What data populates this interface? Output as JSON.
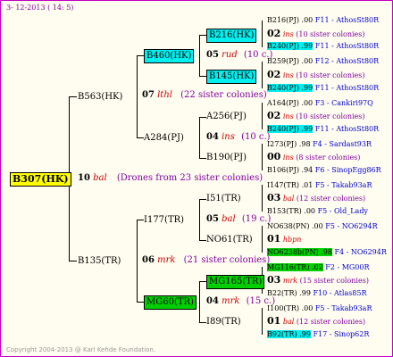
{
  "header": {
    "date": "3- 12-2013 ( 14: 5)"
  },
  "footer": {
    "copyright": "Copyright 2004-2013 @ Karl Kehde Foundation."
  },
  "colors": {
    "frame": "#c000c0",
    "cyan": "#00f0f0",
    "green": "#00d000",
    "root": "#ffff00",
    "blue_text": "#0000cc",
    "purple_text": "#8000a0",
    "red_text": "#cc0000"
  },
  "root": {
    "id": "B307(HK)",
    "num": "10",
    "code": "bal",
    "note": "(Drones from 23 sister colonies)"
  },
  "gen1": {
    "top": {
      "id": "B563(HK)",
      "num": "07",
      "code": "lthl",
      "note": "(22 sister colonies)"
    },
    "bottom": {
      "id": "B135(TR)",
      "num": "06",
      "code": "mrk",
      "note": "(21 sister colonies)"
    }
  },
  "gen2": {
    "a": {
      "id": "B460(HK)",
      "num": "05",
      "code": "rud",
      "note": "(10 c.)"
    },
    "b": {
      "id": "A284(PJ)",
      "num": "04",
      "code": "ins",
      "note": "(10 c.)"
    },
    "c": {
      "id": "I177(TR)",
      "num": "05",
      "code": "bal",
      "note": "(19 c.)"
    },
    "d": {
      "id": "MG60(TR)",
      "num": "04",
      "code": "mrk",
      "note": "(15 c.)"
    }
  },
  "gen3": {
    "a": "B216(HK)",
    "b": "B145(HK)",
    "c": "A256(PJ)",
    "d": "B190(PJ)",
    "e": "I51(TR)",
    "f": "NO61(TR)",
    "g": "MG165(TR)",
    "h": "I89(TR)"
  },
  "gen4": [
    {
      "top": "B216(PJ) .00",
      "top_src": "F11 - AthosSt80R",
      "num": "02",
      "code": "ins",
      "note": "(10 sister colonies)",
      "bot": "B240(PJ) .99",
      "bot_src": "F11 - AthosSt80R"
    },
    {
      "top": "B259(PJ) .00",
      "top_src": "F12 - AthosSt80R",
      "num": "02",
      "code": "ins",
      "note": "(10 sister colonies)",
      "bot": "B240(PJ) .99",
      "bot_src": "F11 - AthosSt80R"
    },
    {
      "top": "A164(PJ) .00",
      "top_src": "F3 - Cankiri97Q",
      "num": "02",
      "code": "ins",
      "note": "(10 sister colonies)",
      "bot": "B240(PJ) .99",
      "bot_src": "F11 - AthosSt80R"
    },
    {
      "top": "I273(PJ) .98",
      "top_src": "F4 - Sardast93R",
      "num": "00",
      "code": "ins",
      "note": "(8 sister colonies)",
      "bot": "B106(PJ) .94",
      "bot_src": "F6 - SinopEgg86R"
    },
    {
      "top": "I147(TR) .01",
      "top_src": "F5 - Takab93aR",
      "num": "03",
      "code": "bal",
      "note": "(12 sister colonies)",
      "bot": "B153(TR) .00",
      "bot_src": "F5 - Old_Lady"
    },
    {
      "top": "NO638(PN) .00",
      "top_src": "F5 - NO6294R",
      "num": "01",
      "code": "hbpn",
      "note": "",
      "bot": "NO6238b(PN) .98",
      "bot_src": "F4 - NO6294R"
    },
    {
      "top": "MG116(TR) .02",
      "top_src": "F2 - MG00R",
      "num": "03",
      "code": "mrk",
      "note": "(15 sister colonies)",
      "bot": "B22(TR) .99",
      "bot_src": "F10 - Atlas85R"
    },
    {
      "top": "I100(TR) .00",
      "top_src": "F5 - Takab93aR",
      "num": "01",
      "code": "bal",
      "note": "(12 sister colonies)",
      "bot": "B92(TR) .99",
      "bot_src": "F17 - Sinop62R"
    }
  ]
}
